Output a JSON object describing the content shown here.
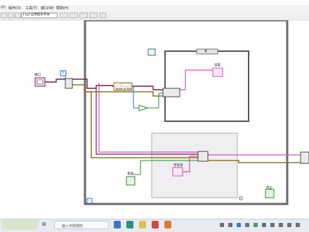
{
  "menu": {
    "items": [
      "(P)",
      "操作(O)",
      "工具(T)",
      "窗口(W)",
      "帮助(H)"
    ]
  },
  "toolbar": {
    "font_select": "17pt 应用程序字体"
  },
  "diagram": {
    "serial_port_label": "端口",
    "case_selector_label": "真",
    "string_indicator_label": "读取",
    "bytes_at_port_label": "Bytes at Port",
    "string_control_label": "字符串",
    "send_button_label": "发送",
    "stop_button_label": "停止",
    "loop_iteration_label": "i",
    "numeric_constant": "0",
    "wire_colors": {
      "refnum": "#6e1f4f",
      "error": "#8a7a2a",
      "string": "#d14fbf",
      "numeric": "#1f6fbf",
      "boolean": "#2c8a2c"
    }
  },
  "taskbar": {
    "search_placeholder": "输入你想搜的"
  }
}
